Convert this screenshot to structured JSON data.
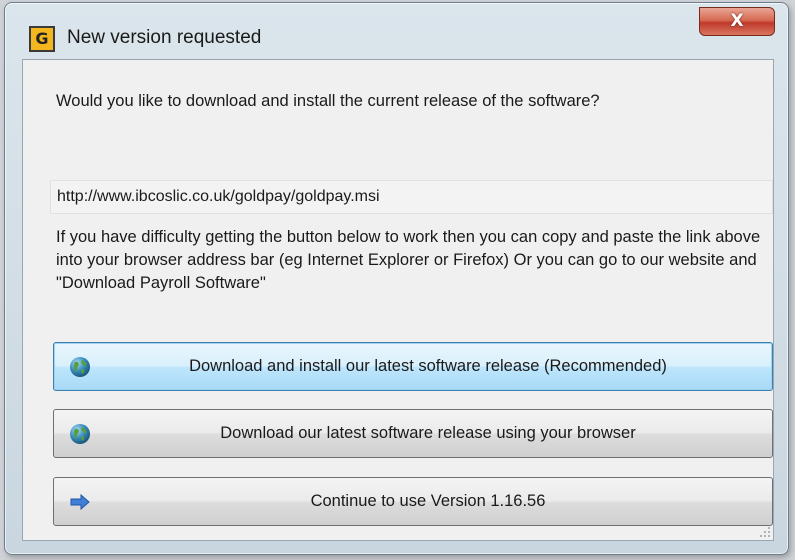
{
  "window": {
    "title": "New version requested",
    "app_icon_letter": "G",
    "close_label": "X"
  },
  "dialog": {
    "question": "Would you like to download and install the current release of the software?",
    "url": "http://www.ibcoslic.co.uk/goldpay/goldpay.msi",
    "help_text": "If you have difficulty getting the button below to work then you can copy and paste the link above into your browser address bar (eg Internet Explorer or Firefox) Or you can go to our website and \"Download Payroll Software\""
  },
  "buttons": {
    "install": {
      "label": "Download  and install our latest software release (Recommended)",
      "icon": "globe-icon"
    },
    "browser": {
      "label": "Download our latest software release using your browser",
      "icon": "globe-icon"
    },
    "continue": {
      "label": "Continue  to use Version 1.16.56",
      "icon": "arrow-right-icon"
    }
  },
  "colors": {
    "accent_border": "#3c7fb1",
    "close_red": "#c0392b",
    "app_icon_bg": "#f3b61f"
  }
}
